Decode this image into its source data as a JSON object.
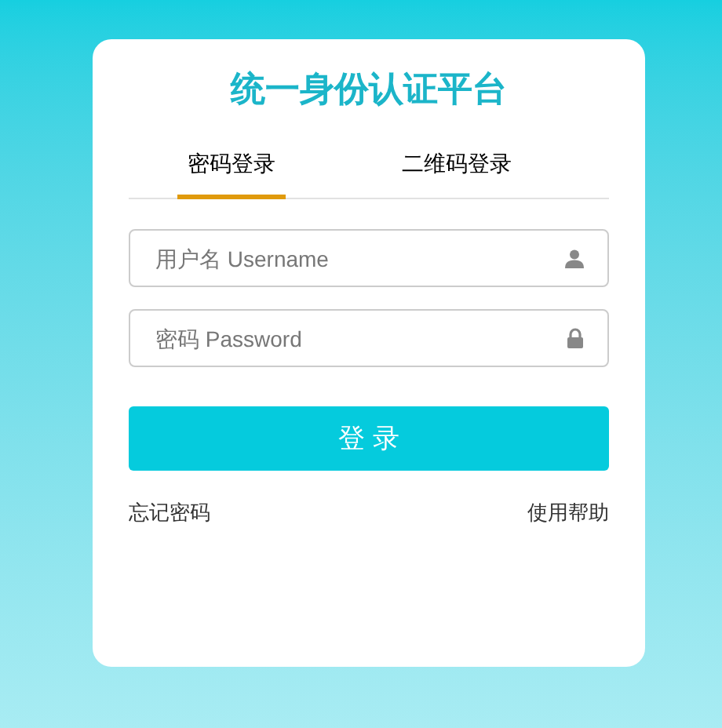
{
  "title": "统一身份认证平台",
  "tabs": [
    {
      "label": "密码登录",
      "selected": true
    },
    {
      "label": "二维码登录",
      "selected": false
    }
  ],
  "fields": [
    {
      "kind": "user",
      "placeholder": "用户名 Username"
    },
    {
      "kind": "lock",
      "placeholder": "密码 Password"
    }
  ],
  "login_button": "登 录",
  "links": [
    "忘记密码",
    "使用帮助"
  ]
}
